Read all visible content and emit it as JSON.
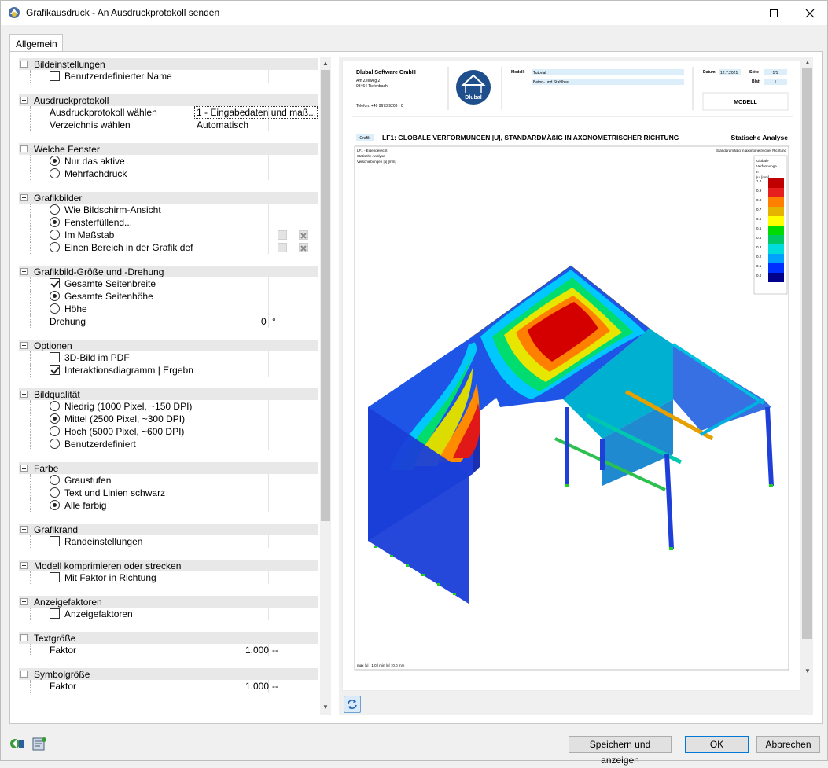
{
  "window": {
    "title": "Grafikausdruck - An Ausdruckprotokoll senden",
    "min_icon": "minimize-icon",
    "max_icon": "maximize-icon",
    "close_icon": "close-icon"
  },
  "tabs": [
    {
      "label": "Allgemein"
    }
  ],
  "tree": {
    "bildeinstellungen": {
      "title": "Bildeinstellungen",
      "benutzerdef": "Benutzerdefinierter Name"
    },
    "ausdruckprotokoll": {
      "title": "Ausdruckprotokoll",
      "waehlen": "Ausdruckprotokoll wählen",
      "waehlen_value": "1 - Eingabedaten und maß...",
      "verzeichnis": "Verzeichnis wählen",
      "verzeichnis_value": "Automatisch"
    },
    "fenster": {
      "title": "Welche Fenster",
      "aktive": "Nur das aktive",
      "mehrfach": "Mehrfachdruck"
    },
    "grafikbilder": {
      "title": "Grafikbilder",
      "bildschirm": "Wie Bildschirm-Ansicht",
      "fenster": "Fensterfüllend...",
      "massstab": "Im Maßstab",
      "bereich": "Einen Bereich in der Grafik defir"
    },
    "groesse": {
      "title": "Grafikbild-Größe und -Drehung",
      "breite": "Gesamte Seitenbreite",
      "hoehe": "Gesamte Seitenhöhe",
      "h": "Höhe",
      "drehung": "Drehung",
      "drehung_value": "0",
      "drehung_unit": "°"
    },
    "optionen": {
      "title": "Optionen",
      "pdf3d": "3D-Bild im PDF",
      "interaktion": "Interaktionsdiagramm | Ergebni"
    },
    "qualitaet": {
      "title": "Bildqualität",
      "niedrig": "Niedrig (1000 Pixel, ~150 DPI)",
      "mittel": "Mittel (2500 Pixel, ~300 DPI)",
      "hoch": "Hoch (5000 Pixel, ~600 DPI)",
      "benutzer": "Benutzerdefiniert"
    },
    "farbe": {
      "title": "Farbe",
      "grau": "Graustufen",
      "schwarz": "Text und Linien schwarz",
      "farbig": "Alle farbig"
    },
    "rand": {
      "title": "Grafikrand",
      "rand": "Randeinstellungen"
    },
    "modell": {
      "title": "Modell komprimieren oder strecken",
      "faktor": "Mit Faktor in Richtung"
    },
    "anzeige": {
      "title": "Anzeigefaktoren",
      "faktoren": "Anzeigefaktoren"
    },
    "textgroesse": {
      "title": "Textgröße",
      "faktor": "Faktor",
      "value": "1.000",
      "unit": "--"
    },
    "symbolgroesse": {
      "title": "Symbolgröße",
      "faktor": "Faktor",
      "value": "1.000",
      "unit": "--"
    }
  },
  "preview": {
    "company": "Dlubal Software GmbH",
    "street": "Am Zellweg 2",
    "city": "93464 Tiefenbach",
    "phone": "Telefon: +49 9673 9203 - 0",
    "logo_text": "Dlubal",
    "modell_label": "Modell:",
    "modell_value": "Tutorial",
    "modell_sub": "Beton- und Stahlbau",
    "datum_label": "Datum",
    "datum_value": "12.7.2021",
    "seite_label": "Seite",
    "seite_value": "1/1",
    "blatt_label": "Blatt",
    "blatt_value": "1",
    "modell_box": "MODELL",
    "grafik_tag": "Grafik",
    "heading": "LF1: GLOBALE VERFORMUNGEN |U|, STANDARDMÄßIG IN AXONOMETRISCHER RICHTUNG",
    "heading_right": "Statische Analyse",
    "info1": "LF1 - Eigengewicht",
    "info2": "Statische Analyse",
    "info3": "Verschiebungen |u| [mm]",
    "info_right": "Standardmäßig in axonometrischer Richtung",
    "legend_title1": "Globale",
    "legend_title2": "Verformunge",
    "legend_title3": "n",
    "legend_title4": "|u| [mm]",
    "footer": "max |u| : 1.0 | min |u| : 0.0 mm",
    "legend_colors": [
      "#c00000",
      "#e61e1e",
      "#ff8000",
      "#e6b400",
      "#ffff00",
      "#00dc00",
      "#00c864",
      "#00dcdc",
      "#00a0ff",
      "#0030ff",
      "#00008c"
    ],
    "legend_values": [
      "1.0",
      "0.9",
      "0.8",
      "0.7",
      "0.6",
      "0.5",
      "0.4",
      "0.3",
      "0.2",
      "0.1",
      "0.0"
    ]
  },
  "buttons": {
    "save_show": "Speichern und anzeigen",
    "ok": "OK",
    "cancel": "Abbrechen"
  }
}
